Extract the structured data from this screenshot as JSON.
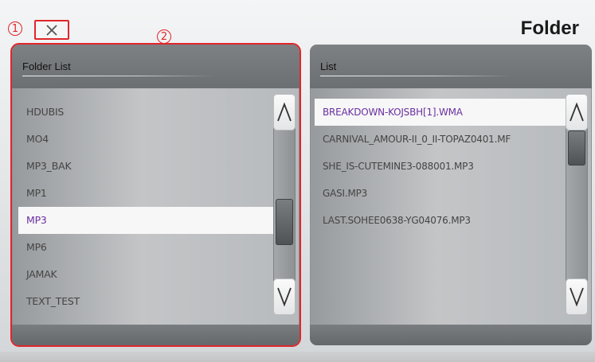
{
  "header": {
    "title": "Folder",
    "close_label": "×"
  },
  "annotations": {
    "marker1": "1",
    "marker2": "2",
    "color": "#e0262b"
  },
  "folder_panel": {
    "header": "Folder List",
    "items": [
      {
        "label": "HDUBIS",
        "selected": false
      },
      {
        "label": "MO4",
        "selected": false
      },
      {
        "label": "MP3_BAK",
        "selected": false
      },
      {
        "label": "MP1",
        "selected": false
      },
      {
        "label": "MP3",
        "selected": true
      },
      {
        "label": "MP6",
        "selected": false
      },
      {
        "label": "JAMAK",
        "selected": false
      },
      {
        "label": "TEXT_TEST",
        "selected": false
      }
    ]
  },
  "file_panel": {
    "header": "List",
    "items": [
      {
        "label": "BREAKDOWN-KOJSBH[1].WMA",
        "selected": true
      },
      {
        "label": "CARNIVAL_AMOUR-II_0_II-TOPAZ0401.MF",
        "selected": false
      },
      {
        "label": "SHE_IS-CUTEMINE3-088001.MP3",
        "selected": false
      },
      {
        "label": "GASI.MP3",
        "selected": false
      },
      {
        "label": "LAST.SOHEE0638-YG04076.MP3",
        "selected": false
      }
    ]
  },
  "icons": {
    "close": "close-icon",
    "scroll_up": "chevron-up-icon",
    "scroll_down": "chevron-down-icon"
  },
  "colors": {
    "selected_text": "#6a2fa0",
    "highlight_border": "#e0262b"
  }
}
